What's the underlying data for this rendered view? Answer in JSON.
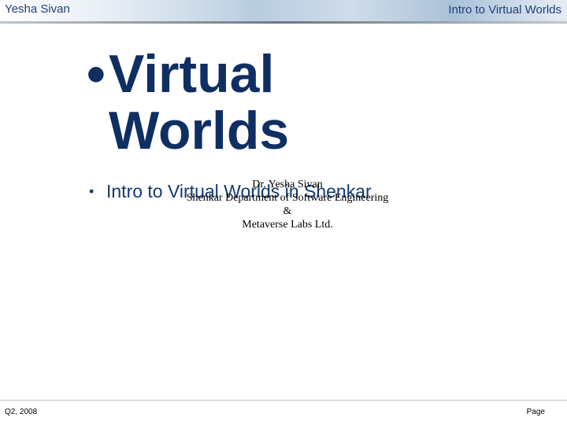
{
  "header": {
    "author": "Yesha Sivan",
    "course_title": "Intro to Virtual Worlds"
  },
  "slide": {
    "title_bullet": "•",
    "title_line1": "Virtual",
    "title_line2": "Worlds",
    "bullet_marker": "•",
    "bullet_text": "Intro to Virtual Worlds in Shenkar",
    "author_lines": [
      "Dr. Yesha Sivan",
      "Shenkar Department of Software Engineering",
      "&",
      "Metaverse Labs Ltd."
    ]
  },
  "footer": {
    "date": "Q2, 2008",
    "page_label": "Page"
  }
}
